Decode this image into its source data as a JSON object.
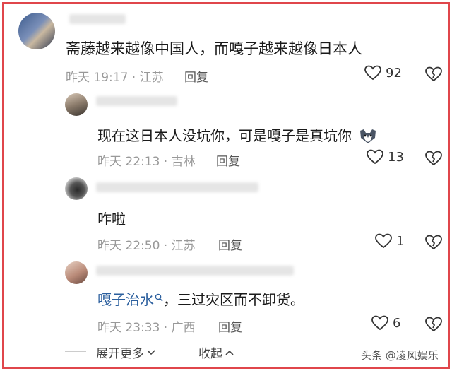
{
  "comments": [
    {
      "text": "斋藤越来越像中国人，而嘎子越来越像日本人",
      "time": "昨天 19:17 · 江苏",
      "reply": "回复",
      "likes": "92"
    },
    {
      "text": "现在这日本人没坑你，可是嘎子是真坑你",
      "time": "昨天 22:13 · 吉林",
      "reply": "回复",
      "likes": "13"
    },
    {
      "text": "咋啦",
      "time": "昨天 22:50 · 江苏",
      "reply": "回复",
      "likes": "1"
    },
    {
      "link": "嘎子治水",
      "text": "，三过灾区而不卸货。",
      "time": "昨天 23:33 · 广西",
      "reply": "回复",
      "likes": "6"
    }
  ],
  "footer": {
    "expand": "展开更多",
    "collapse": "收起"
  },
  "watermark": "头条 @凌风娱乐",
  "colors": {
    "border": "#e0464b",
    "link": "#2b5f9e",
    "meta": "#999999"
  }
}
